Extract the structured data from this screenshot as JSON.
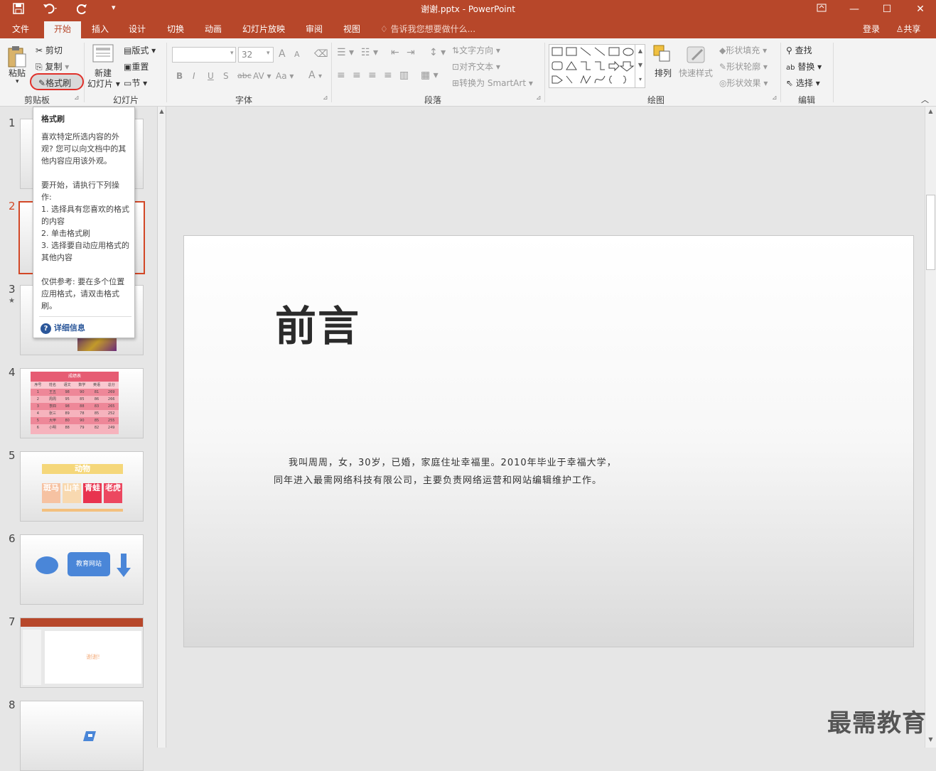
{
  "title": "谢谢.pptx - PowerPoint",
  "quick_access": {
    "save_icon": "save-icon",
    "undo_icon": "undo-icon",
    "redo_icon": "redo-icon",
    "customize_icon": "customize-icon"
  },
  "window_controls": {
    "restore_ribbon": "ribbon-display-icon",
    "minimize": "minimize-icon",
    "maximize": "maximize-icon",
    "close": "close-icon"
  },
  "tabs": [
    "文件",
    "开始",
    "插入",
    "设计",
    "切换",
    "动画",
    "幻灯片放映",
    "审阅",
    "视图"
  ],
  "tell_me": "告诉我您想要做什么...",
  "login": "登录",
  "share": "共享",
  "clipboard": {
    "paste": "粘贴",
    "cut": "剪切",
    "copy": "复制",
    "format_painter": "格式刷",
    "label": "剪贴板"
  },
  "slides_group": {
    "new_slide_line1": "新建",
    "new_slide_line2": "幻灯片",
    "layout": "版式",
    "reset": "重置",
    "section": "节",
    "label": "幻灯片"
  },
  "font_group": {
    "font_size": "32",
    "bold": "B",
    "italic": "I",
    "underline": "U",
    "shadow": "S",
    "strike": "abc",
    "spacing": "AV",
    "case": "Aa",
    "font_color": "A",
    "grow": "A",
    "shrink": "A",
    "label": "字体"
  },
  "paragraph_group": {
    "text_direction": "文字方向",
    "align_text": "对齐文本",
    "smartart": "转换为 SmartArt",
    "label": "段落"
  },
  "drawing_group": {
    "arrange": "排列",
    "quick_styles": "快速样式",
    "shape_fill": "形状填充",
    "shape_outline": "形状轮廓",
    "shape_effects": "形状效果",
    "label": "绘图"
  },
  "editing_group": {
    "find": "查找",
    "replace": "替换",
    "select": "选择",
    "label": "编辑"
  },
  "tooltip": {
    "heading": "格式刷",
    "desc": "喜欢特定所选内容的外观? 您可以向文档中的其他内容应用该外观。",
    "start": "要开始，请执行下列操作:",
    "step1": "1. 选择具有您喜欢的格式的内容",
    "step2": "2. 单击格式刷",
    "step3": "3. 选择要自动应用格式的其他内容",
    "tip": "仅供参考: 要在多个位置应用格式，请双击格式刷。",
    "more": "详细信息"
  },
  "thumbnails": [
    "1",
    "2",
    "3",
    "4",
    "5",
    "6",
    "7",
    "8"
  ],
  "thumb3_star": "★",
  "thumb4": {
    "title": "成绩表",
    "headers": [
      "序号",
      "姓名",
      "语文",
      "数学",
      "英语",
      "总分"
    ],
    "rows": [
      [
        "1",
        "王五",
        "98",
        "90",
        "81",
        "269"
      ],
      [
        "2",
        "周周",
        "95",
        "85",
        "86",
        "266"
      ],
      [
        "3",
        "李四",
        "98",
        "88",
        "83",
        "265"
      ],
      [
        "4",
        "张三",
        "89",
        "78",
        "85",
        "252"
      ],
      [
        "5",
        "大甲",
        "80",
        "90",
        "85",
        "255"
      ],
      [
        "6",
        "小明",
        "88",
        "79",
        "82",
        "249"
      ]
    ]
  },
  "thumb5": {
    "title": "动物",
    "cells": [
      "斑马",
      "山羊",
      "青蛙",
      "老虎"
    ]
  },
  "thumb6": {
    "box": "教育网站"
  },
  "thumb7": {
    "text": "谢谢!"
  },
  "slide": {
    "title": "前言",
    "body_line1": "我叫周周，女，30岁，已婚，家庭住址幸福里。2010年毕业于幸福大学，",
    "body_line2": "同年进入最需网络科技有限公司，主要负责网络运营和网站编辑维护工作。"
  },
  "watermark": "最需教育",
  "colors": {
    "accent": "#b7472a",
    "selected": "#d24726"
  }
}
